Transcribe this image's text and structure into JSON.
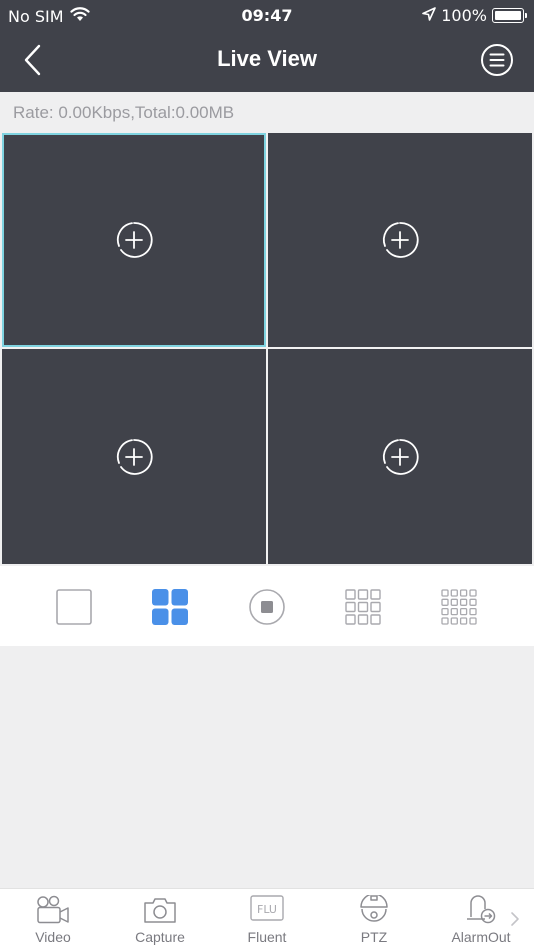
{
  "status_bar": {
    "carrier": "No SIM",
    "time": "09:47",
    "battery_percent": "100%",
    "battery_level": 1.0,
    "icons": [
      "wifi-icon",
      "location-arrow-icon",
      "battery-icon"
    ]
  },
  "nav": {
    "title": "Live View",
    "back_icon": "chevron-left-icon",
    "menu_icon": "menu-circle-icon"
  },
  "rate": {
    "text": "Rate: 0.00Kbps,Total:0.00MB"
  },
  "panes": [
    {
      "icon": "add-channel-icon",
      "selected": true
    },
    {
      "icon": "add-channel-icon",
      "selected": false
    },
    {
      "icon": "add-channel-icon",
      "selected": false
    },
    {
      "icon": "add-channel-icon",
      "selected": false
    }
  ],
  "layouts": [
    {
      "icon": "single-view-icon",
      "active": false
    },
    {
      "icon": "quad-view-icon",
      "active": true
    },
    {
      "icon": "stop-icon",
      "active": false
    },
    {
      "icon": "nine-view-icon",
      "active": false
    },
    {
      "icon": "sixteen-view-icon",
      "active": false
    }
  ],
  "colors": {
    "header_bg": "#40424a",
    "selected_outline": "#7fd3e0",
    "accent": "#4a90e8",
    "inactive_icon": "#a9a9ae"
  },
  "tabs": [
    {
      "label": "Video",
      "icon": "video-camera-icon"
    },
    {
      "label": "Capture",
      "icon": "camera-icon"
    },
    {
      "label": "Fluent",
      "icon": "fluent-quality-icon",
      "icon_text": "FLU"
    },
    {
      "label": "PTZ",
      "icon": "ptz-dome-camera-icon"
    },
    {
      "label": "AlarmOut",
      "icon": "alarm-out-icon"
    }
  ],
  "more_icon": "chevron-right-icon"
}
